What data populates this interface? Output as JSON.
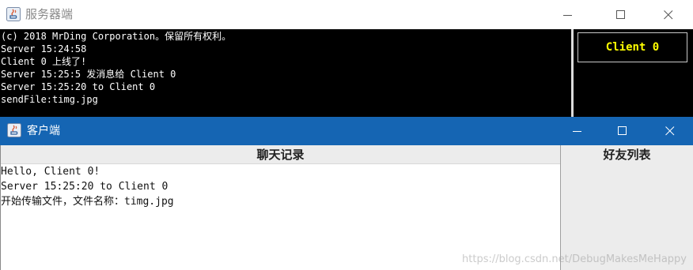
{
  "server_window": {
    "title": "服务器端",
    "console_lines": [
      "(c) 2018 MrDing Corporation。保留所有权利。",
      "Server 15:24:58",
      "Client 0 上线了!",
      "Server 15:25:5 发消息给 Client 0",
      "Server 15:25:20 to Client 0",
      "sendFile:timg.jpg"
    ],
    "client_button_label": "Client 0",
    "client_button_color": "#ffff00"
  },
  "client_window": {
    "title": "客户端",
    "titlebar_color": "#1565b3",
    "chat_header": "聊天记录",
    "chat_lines": [
      "Hello, Client 0!",
      "Server 15:25:20 to Client 0",
      "开始传输文件，文件名称：timg.jpg"
    ],
    "friends_header": "好友列表"
  },
  "watermark": "https://blog.csdn.net/DebugMakesMeHappy",
  "icons": {
    "app": "java-app-icon",
    "minimize": "minimize-icon",
    "maximize": "maximize-icon",
    "close": "close-icon"
  }
}
